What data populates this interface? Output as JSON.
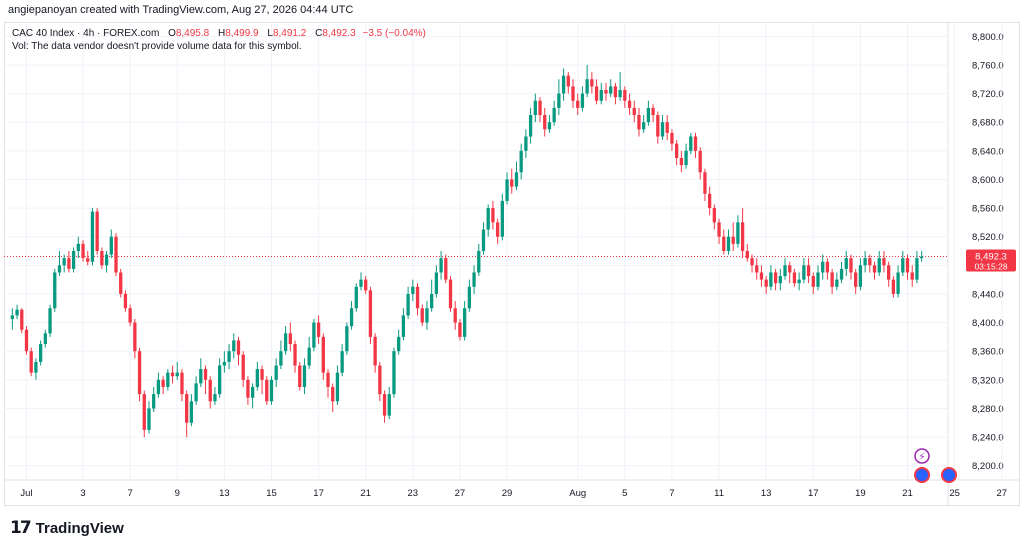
{
  "header": {
    "credit": "angiepanoyan created with TradingView.com, Aug 27, 2026 04:44 UTC"
  },
  "legend": {
    "symbol": "CAC 40 Index · 4h · FOREX.com",
    "open_label": "O",
    "open": "8,495.8",
    "high_label": "H",
    "high": "8,499.9",
    "low_label": "L",
    "low": "8,491.2",
    "close_label": "C",
    "close": "8,492.3",
    "change": "−3.5 (−0.04%)",
    "volume_note": "Vol: The data vendor doesn't provide volume data for this symbol."
  },
  "price_tag": {
    "price": "8,492.3",
    "countdown": "03:15:28"
  },
  "footer": {
    "brand": "TradingView"
  },
  "colors": {
    "up": "#089981",
    "down": "#f23645",
    "grid": "#f0f3fa",
    "axis_text": "#131722",
    "last_price": "#f23645"
  },
  "icons": {
    "logo": "tradingview-logo-icon",
    "event1": "lightning-icon",
    "event2": "dividend-dot-icon"
  },
  "chart_data": {
    "type": "candlestick",
    "interval": "4h",
    "ylim": [
      8180,
      8820
    ],
    "yticks": [
      8200,
      8240,
      8280,
      8320,
      8360,
      8400,
      8440,
      8480,
      8520,
      8560,
      8600,
      8640,
      8680,
      8720,
      8760,
      8800
    ],
    "ytick_labels": [
      "8,200.0",
      "8,240.0",
      "8,280.0",
      "8,320.0",
      "8,360.0",
      "8,400.0",
      "8,440.0",
      "8,480.0",
      "8,520.0",
      "8,560.0",
      "8,600.0",
      "8,640.0",
      "8,680.0",
      "8,720.0",
      "8,760.0",
      "8,800.0"
    ],
    "xticks": [
      {
        "label": "Jul",
        "bar": 3
      },
      {
        "label": "3",
        "bar": 15
      },
      {
        "label": "7",
        "bar": 25
      },
      {
        "label": "9",
        "bar": 35
      },
      {
        "label": "13",
        "bar": 45
      },
      {
        "label": "15",
        "bar": 55
      },
      {
        "label": "17",
        "bar": 65
      },
      {
        "label": "21",
        "bar": 75
      },
      {
        "label": "23",
        "bar": 85
      },
      {
        "label": "27",
        "bar": 95
      },
      {
        "label": "29",
        "bar": 105
      },
      {
        "label": "Aug",
        "bar": 120
      },
      {
        "label": "5",
        "bar": 130
      },
      {
        "label": "7",
        "bar": 140
      },
      {
        "label": "11",
        "bar": 150
      },
      {
        "label": "13",
        "bar": 160
      },
      {
        "label": "17",
        "bar": 170
      },
      {
        "label": "19",
        "bar": 180
      },
      {
        "label": "21",
        "bar": 190
      },
      {
        "label": "25",
        "bar": 200
      },
      {
        "label": "27",
        "bar": 210
      }
    ],
    "last_price": 8492.3,
    "candles": [
      [
        8405,
        8410,
        8390,
        8420
      ],
      [
        8410,
        8418,
        8405,
        8425
      ],
      [
        8418,
        8390,
        8385,
        8420
      ],
      [
        8390,
        8360,
        8355,
        8395
      ],
      [
        8360,
        8330,
        8325,
        8365
      ],
      [
        8330,
        8345,
        8320,
        8350
      ],
      [
        8345,
        8370,
        8340,
        8375
      ],
      [
        8370,
        8385,
        8365,
        8390
      ],
      [
        8385,
        8420,
        8380,
        8425
      ],
      [
        8420,
        8470,
        8415,
        8475
      ],
      [
        8470,
        8480,
        8465,
        8500
      ],
      [
        8480,
        8490,
        8470,
        8495
      ],
      [
        8490,
        8475,
        8470,
        8500
      ],
      [
        8475,
        8500,
        8470,
        8505
      ],
      [
        8500,
        8510,
        8490,
        8520
      ],
      [
        8510,
        8490,
        8485,
        8515
      ],
      [
        8490,
        8485,
        8480,
        8500
      ],
      [
        8485,
        8555,
        8480,
        8560
      ],
      [
        8555,
        8500,
        8495,
        8560
      ],
      [
        8500,
        8480,
        8475,
        8505
      ],
      [
        8480,
        8495,
        8470,
        8500
      ],
      [
        8495,
        8520,
        8490,
        8530
      ],
      [
        8520,
        8470,
        8465,
        8525
      ],
      [
        8470,
        8440,
        8435,
        8475
      ],
      [
        8440,
        8420,
        8415,
        8445
      ],
      [
        8420,
        8400,
        8395,
        8425
      ],
      [
        8400,
        8360,
        8350,
        8405
      ],
      [
        8360,
        8300,
        8290,
        8365
      ],
      [
        8300,
        8250,
        8240,
        8305
      ],
      [
        8250,
        8280,
        8245,
        8290
      ],
      [
        8280,
        8300,
        8275,
        8310
      ],
      [
        8300,
        8320,
        8295,
        8330
      ],
      [
        8320,
        8310,
        8300,
        8325
      ],
      [
        8310,
        8330,
        8305,
        8335
      ],
      [
        8330,
        8325,
        8315,
        8340
      ],
      [
        8325,
        8330,
        8320,
        8345
      ],
      [
        8330,
        8300,
        8290,
        8335
      ],
      [
        8300,
        8260,
        8240,
        8305
      ],
      [
        8260,
        8290,
        8255,
        8300
      ],
      [
        8290,
        8315,
        8285,
        8325
      ],
      [
        8315,
        8335,
        8310,
        8350
      ],
      [
        8335,
        8320,
        8300,
        8340
      ],
      [
        8320,
        8290,
        8280,
        8325
      ],
      [
        8290,
        8300,
        8285,
        8310
      ],
      [
        8300,
        8340,
        8295,
        8350
      ],
      [
        8340,
        8345,
        8330,
        8360
      ],
      [
        8345,
        8360,
        8335,
        8370
      ],
      [
        8360,
        8375,
        8350,
        8385
      ],
      [
        8375,
        8355,
        8340,
        8380
      ],
      [
        8355,
        8320,
        8310,
        8360
      ],
      [
        8320,
        8295,
        8285,
        8325
      ],
      [
        8295,
        8310,
        8280,
        8315
      ],
      [
        8310,
        8335,
        8305,
        8345
      ],
      [
        8335,
        8320,
        8300,
        8340
      ],
      [
        8320,
        8290,
        8285,
        8325
      ],
      [
        8290,
        8320,
        8285,
        8325
      ],
      [
        8320,
        8340,
        8310,
        8350
      ],
      [
        8340,
        8360,
        8335,
        8375
      ],
      [
        8360,
        8385,
        8355,
        8395
      ],
      [
        8385,
        8370,
        8360,
        8400
      ],
      [
        8370,
        8340,
        8330,
        8375
      ],
      [
        8340,
        8310,
        8305,
        8345
      ],
      [
        8310,
        8340,
        8300,
        8350
      ],
      [
        8340,
        8365,
        8335,
        8380
      ],
      [
        8365,
        8400,
        8360,
        8405
      ],
      [
        8400,
        8380,
        8370,
        8410
      ],
      [
        8380,
        8330,
        8320,
        8385
      ],
      [
        8330,
        8310,
        8295,
        8335
      ],
      [
        8310,
        8290,
        8275,
        8315
      ],
      [
        8290,
        8330,
        8285,
        8340
      ],
      [
        8330,
        8360,
        8325,
        8370
      ],
      [
        8360,
        8395,
        8355,
        8400
      ],
      [
        8395,
        8420,
        8390,
        8430
      ],
      [
        8420,
        8450,
        8415,
        8455
      ],
      [
        8450,
        8460,
        8445,
        8470
      ],
      [
        8460,
        8445,
        8440,
        8465
      ],
      [
        8445,
        8380,
        8370,
        8450
      ],
      [
        8380,
        8340,
        8330,
        8385
      ],
      [
        8340,
        8300,
        8290,
        8345
      ],
      [
        8300,
        8270,
        8260,
        8305
      ],
      [
        8270,
        8300,
        8265,
        8310
      ],
      [
        8300,
        8360,
        8295,
        8365
      ],
      [
        8360,
        8380,
        8355,
        8390
      ],
      [
        8380,
        8410,
        8375,
        8420
      ],
      [
        8410,
        8440,
        8405,
        8450
      ],
      [
        8440,
        8450,
        8430,
        8460
      ],
      [
        8450,
        8420,
        8410,
        8455
      ],
      [
        8420,
        8400,
        8395,
        8425
      ],
      [
        8400,
        8420,
        8390,
        8430
      ],
      [
        8420,
        8440,
        8415,
        8460
      ],
      [
        8440,
        8470,
        8435,
        8480
      ],
      [
        8470,
        8490,
        8460,
        8500
      ],
      [
        8490,
        8460,
        8455,
        8495
      ],
      [
        8460,
        8420,
        8415,
        8465
      ],
      [
        8420,
        8400,
        8390,
        8430
      ],
      [
        8400,
        8380,
        8375,
        8405
      ],
      [
        8380,
        8420,
        8375,
        8430
      ],
      [
        8420,
        8450,
        8415,
        8460
      ],
      [
        8450,
        8470,
        8440,
        8480
      ],
      [
        8470,
        8500,
        8465,
        8510
      ],
      [
        8500,
        8530,
        8495,
        8540
      ],
      [
        8530,
        8560,
        8520,
        8565
      ],
      [
        8560,
        8540,
        8530,
        8570
      ],
      [
        8540,
        8520,
        8510,
        8545
      ],
      [
        8520,
        8570,
        8515,
        8580
      ],
      [
        8570,
        8600,
        8565,
        8610
      ],
      [
        8600,
        8590,
        8580,
        8615
      ],
      [
        8590,
        8610,
        8585,
        8625
      ],
      [
        8610,
        8640,
        8600,
        8650
      ],
      [
        8640,
        8660,
        8630,
        8670
      ],
      [
        8660,
        8690,
        8650,
        8700
      ],
      [
        8690,
        8710,
        8680,
        8720
      ],
      [
        8710,
        8690,
        8680,
        8715
      ],
      [
        8690,
        8670,
        8660,
        8700
      ],
      [
        8670,
        8680,
        8665,
        8690
      ],
      [
        8680,
        8700,
        8675,
        8710
      ],
      [
        8700,
        8720,
        8690,
        8740
      ],
      [
        8720,
        8745,
        8710,
        8755
      ],
      [
        8745,
        8730,
        8720,
        8750
      ],
      [
        8730,
        8710,
        8700,
        8740
      ],
      [
        8710,
        8700,
        8690,
        8720
      ],
      [
        8700,
        8720,
        8695,
        8730
      ],
      [
        8720,
        8740,
        8715,
        8760
      ],
      [
        8740,
        8730,
        8720,
        8750
      ],
      [
        8730,
        8710,
        8705,
        8740
      ],
      [
        8710,
        8725,
        8705,
        8735
      ],
      [
        8725,
        8720,
        8710,
        8735
      ],
      [
        8720,
        8730,
        8715,
        8740
      ],
      [
        8730,
        8715,
        8705,
        8735
      ],
      [
        8715,
        8725,
        8710,
        8750
      ],
      [
        8725,
        8710,
        8700,
        8730
      ],
      [
        8710,
        8700,
        8690,
        8720
      ],
      [
        8700,
        8690,
        8680,
        8710
      ],
      [
        8690,
        8670,
        8660,
        8700
      ],
      [
        8670,
        8680,
        8665,
        8690
      ],
      [
        8680,
        8700,
        8675,
        8710
      ],
      [
        8700,
        8690,
        8680,
        8705
      ],
      [
        8690,
        8660,
        8650,
        8695
      ],
      [
        8660,
        8680,
        8655,
        8690
      ],
      [
        8680,
        8665,
        8655,
        8690
      ],
      [
        8665,
        8650,
        8640,
        8670
      ],
      [
        8650,
        8630,
        8620,
        8655
      ],
      [
        8630,
        8620,
        8610,
        8640
      ],
      [
        8620,
        8640,
        8615,
        8650
      ],
      [
        8640,
        8660,
        8635,
        8665
      ],
      [
        8660,
        8640,
        8630,
        8665
      ],
      [
        8640,
        8610,
        8600,
        8645
      ],
      [
        8610,
        8580,
        8570,
        8615
      ],
      [
        8580,
        8560,
        8550,
        8590
      ],
      [
        8560,
        8540,
        8530,
        8565
      ],
      [
        8540,
        8520,
        8510,
        8545
      ],
      [
        8520,
        8500,
        8495,
        8530
      ],
      [
        8500,
        8520,
        8495,
        8530
      ],
      [
        8520,
        8510,
        8500,
        8540
      ],
      [
        8510,
        8540,
        8505,
        8550
      ],
      [
        8540,
        8500,
        8490,
        8560
      ],
      [
        8500,
        8490,
        8485,
        8510
      ],
      [
        8490,
        8480,
        8470,
        8495
      ],
      [
        8480,
        8470,
        8460,
        8490
      ],
      [
        8470,
        8460,
        8450,
        8480
      ],
      [
        8460,
        8450,
        8440,
        8465
      ],
      [
        8450,
        8470,
        8445,
        8480
      ],
      [
        8470,
        8455,
        8445,
        8475
      ],
      [
        8455,
        8465,
        8445,
        8475
      ],
      [
        8465,
        8480,
        8460,
        8490
      ],
      [
        8480,
        8470,
        8455,
        8485
      ],
      [
        8470,
        8455,
        8450,
        8475
      ],
      [
        8455,
        8460,
        8445,
        8470
      ],
      [
        8460,
        8480,
        8455,
        8490
      ],
      [
        8480,
        8465,
        8455,
        8490
      ],
      [
        8465,
        8450,
        8440,
        8470
      ],
      [
        8450,
        8470,
        8445,
        8480
      ],
      [
        8470,
        8485,
        8460,
        8495
      ],
      [
        8485,
        8470,
        8460,
        8490
      ],
      [
        8470,
        8450,
        8440,
        8475
      ],
      [
        8450,
        8460,
        8445,
        8470
      ],
      [
        8460,
        8475,
        8455,
        8485
      ],
      [
        8475,
        8490,
        8465,
        8500
      ],
      [
        8490,
        8470,
        8460,
        8495
      ],
      [
        8470,
        8450,
        8440,
        8475
      ],
      [
        8450,
        8480,
        8445,
        8490
      ],
      [
        8480,
        8490,
        8470,
        8500
      ],
      [
        8490,
        8480,
        8470,
        8495
      ],
      [
        8480,
        8470,
        8460,
        8485
      ],
      [
        8470,
        8490,
        8465,
        8500
      ],
      [
        8490,
        8480,
        8470,
        8500
      ],
      [
        8480,
        8460,
        8450,
        8485
      ],
      [
        8460,
        8440,
        8435,
        8465
      ],
      [
        8440,
        8470,
        8435,
        8480
      ],
      [
        8470,
        8490,
        8465,
        8500
      ],
      [
        8490,
        8470,
        8460,
        8495
      ],
      [
        8470,
        8460,
        8450,
        8480
      ],
      [
        8460,
        8490,
        8455,
        8500
      ],
      [
        8490,
        8492.3,
        8485,
        8499.9
      ]
    ]
  }
}
